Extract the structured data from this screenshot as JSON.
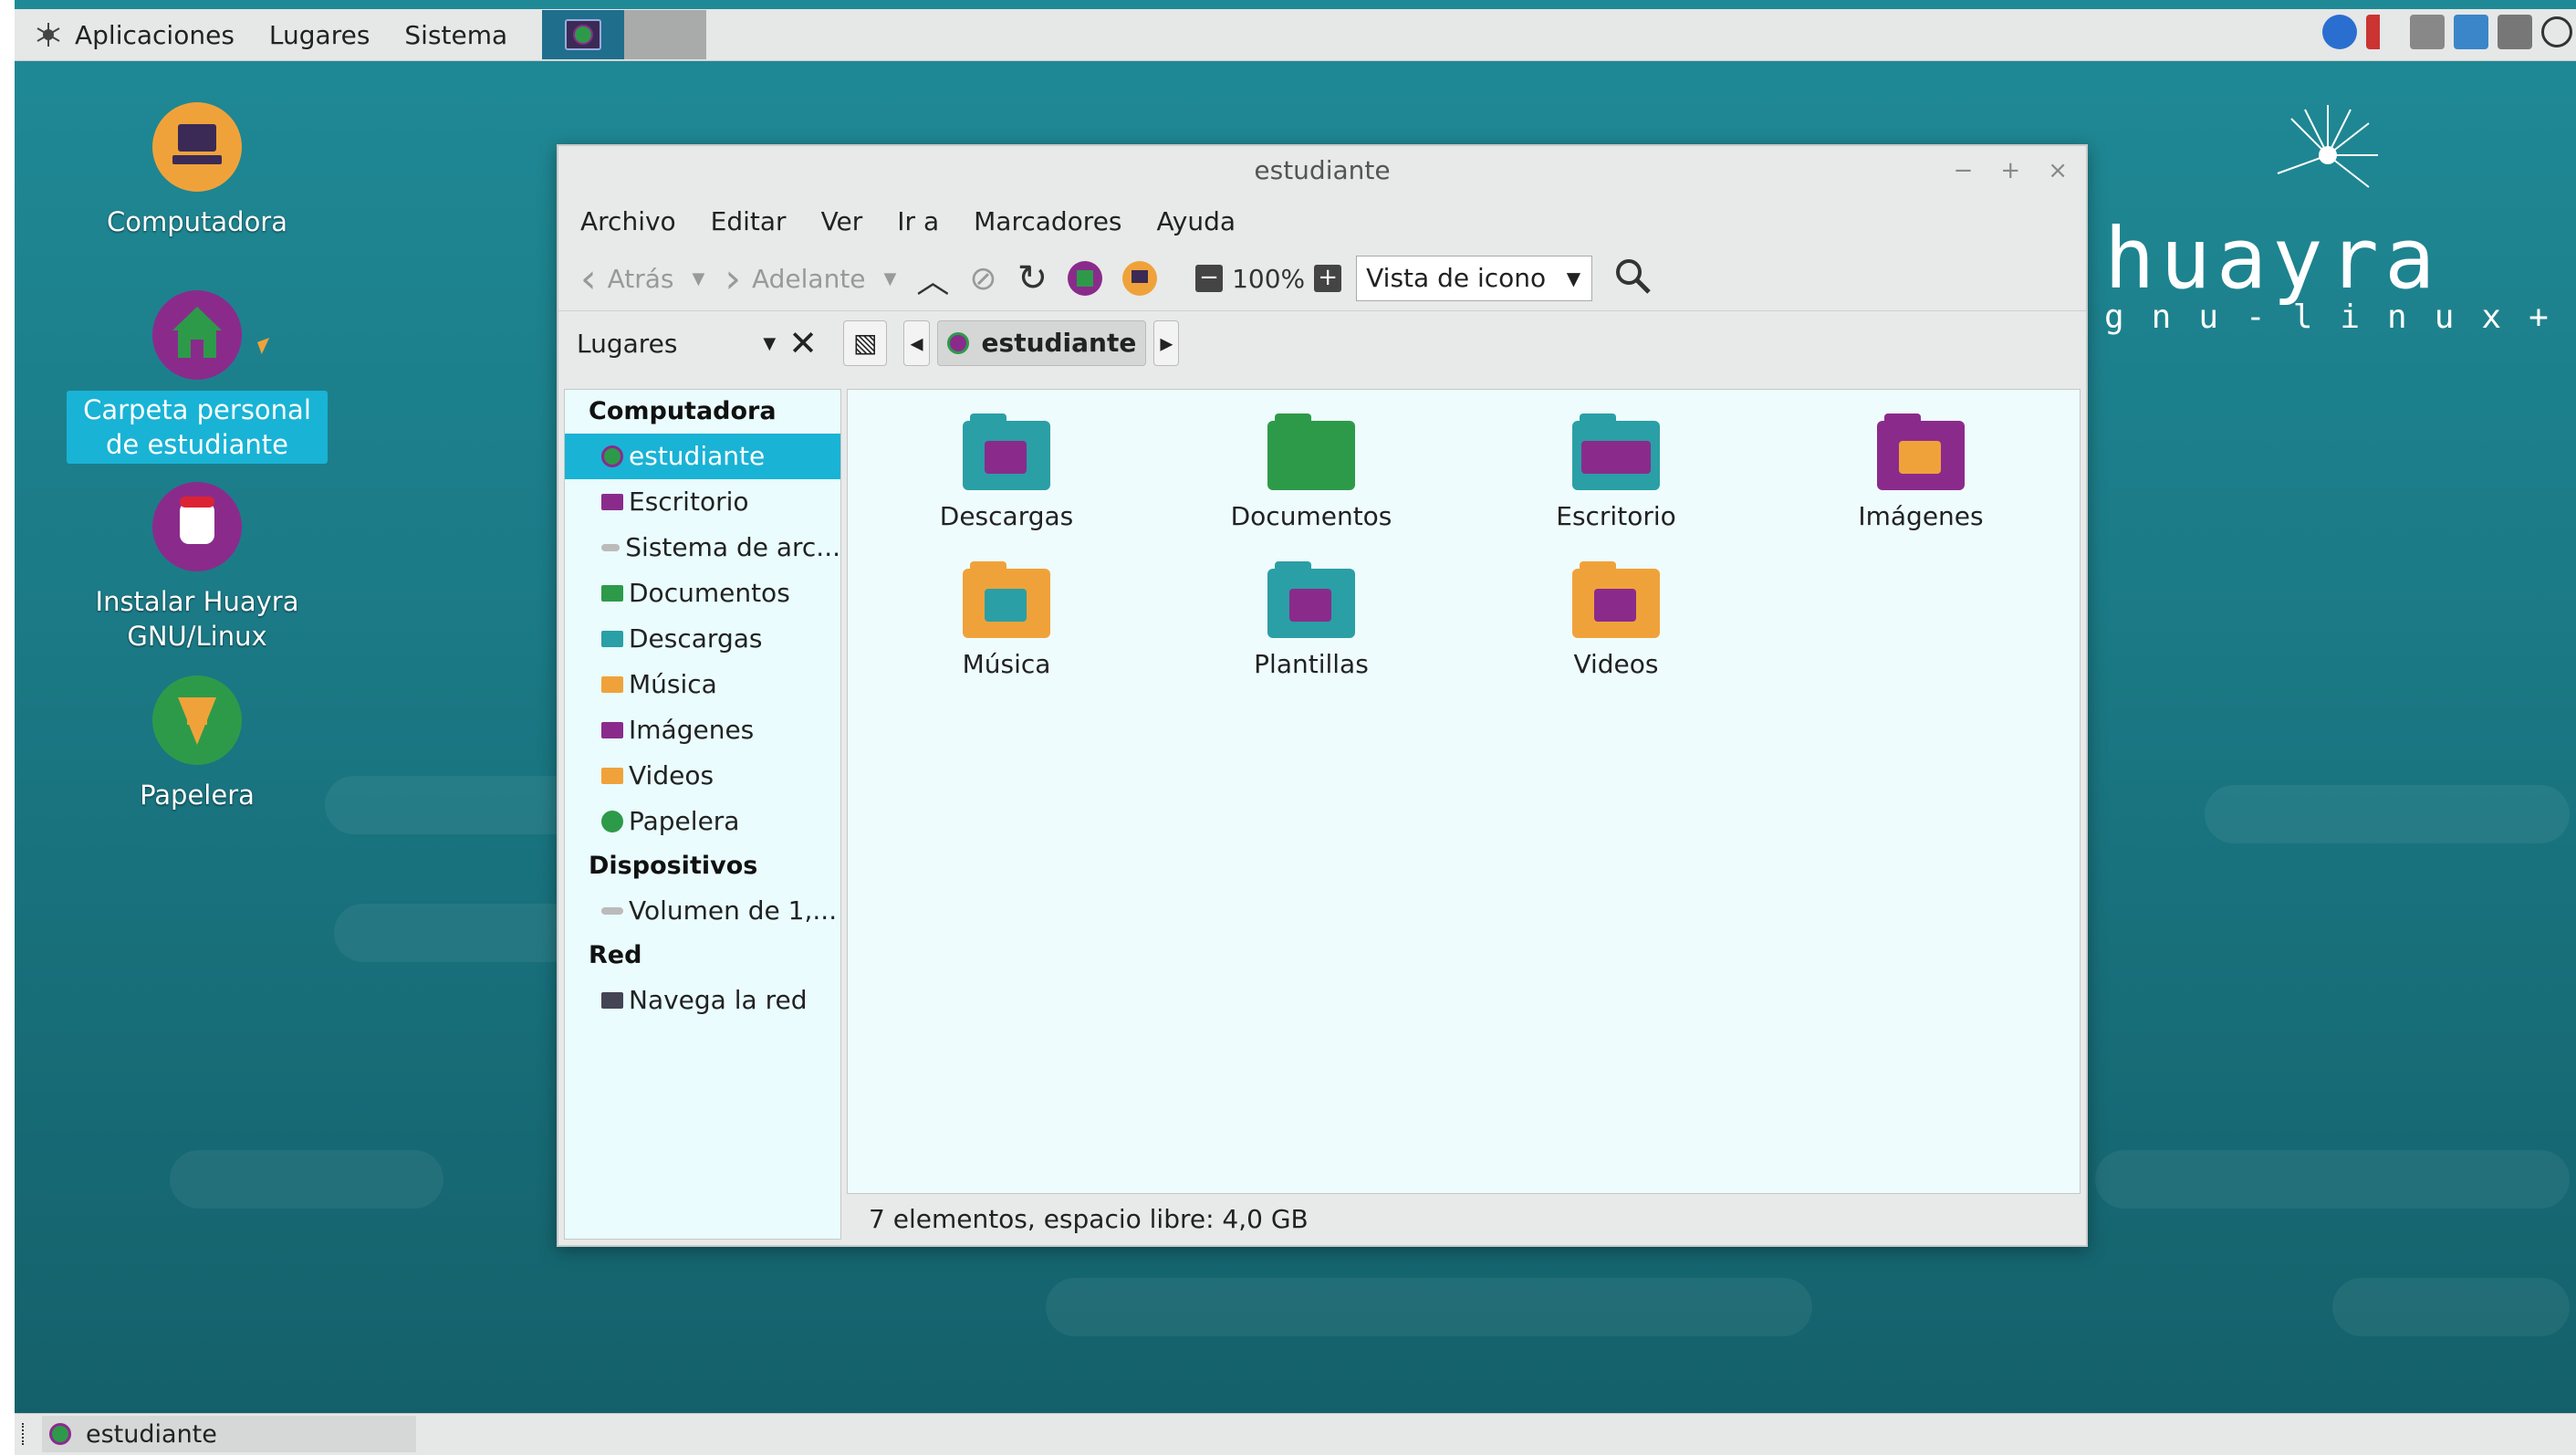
{
  "top_panel": {
    "menus": [
      "Aplicaciones",
      "Lugares",
      "Sistema"
    ]
  },
  "desktop": {
    "icons": [
      {
        "label": "Computadora"
      },
      {
        "label": "Carpeta personal de estudiante"
      },
      {
        "label": "Instalar Huayra GNU/Linux"
      },
      {
        "label": "Papelera"
      }
    ],
    "logo": {
      "main": "huayra",
      "sub": "gnu-linux+"
    }
  },
  "window": {
    "title": "estudiante",
    "controls": [
      "−",
      "+",
      "×"
    ],
    "menubar": [
      "Archivo",
      "Editar",
      "Ver",
      "Ir a",
      "Marcadores",
      "Ayuda"
    ],
    "toolbar": {
      "back": "Atrás",
      "forward": "Adelante",
      "zoom": "100%",
      "view_mode": "Vista de icono"
    },
    "location": {
      "places_label": "Lugares",
      "current": "estudiante"
    },
    "sidebar": {
      "sections": [
        {
          "heading": "Computadora",
          "items": [
            "estudiante",
            "Escritorio",
            "Sistema de arc...",
            "Documentos",
            "Descargas",
            "Música",
            "Imágenes",
            "Videos",
            "Papelera"
          ]
        },
        {
          "heading": "Dispositivos",
          "items": [
            "Volumen de 1,..."
          ]
        },
        {
          "heading": "Red",
          "items": [
            "Navega la red"
          ]
        }
      ],
      "selected": "estudiante"
    },
    "files": [
      "Descargas",
      "Documentos",
      "Escritorio",
      "Imágenes",
      "Música",
      "Plantillas",
      "Videos"
    ],
    "status": "7 elementos, espacio libre: 4,0 GB"
  },
  "bottom_panel": {
    "task": "estudiante"
  },
  "colors": {
    "accent": "#19b3d6",
    "desktop_bg": "#1b7b87",
    "folder_teal": "#2a9fa6",
    "folder_green": "#2d9a4a",
    "folder_purple": "#8a2b8c",
    "folder_orange": "#f0a23a"
  }
}
